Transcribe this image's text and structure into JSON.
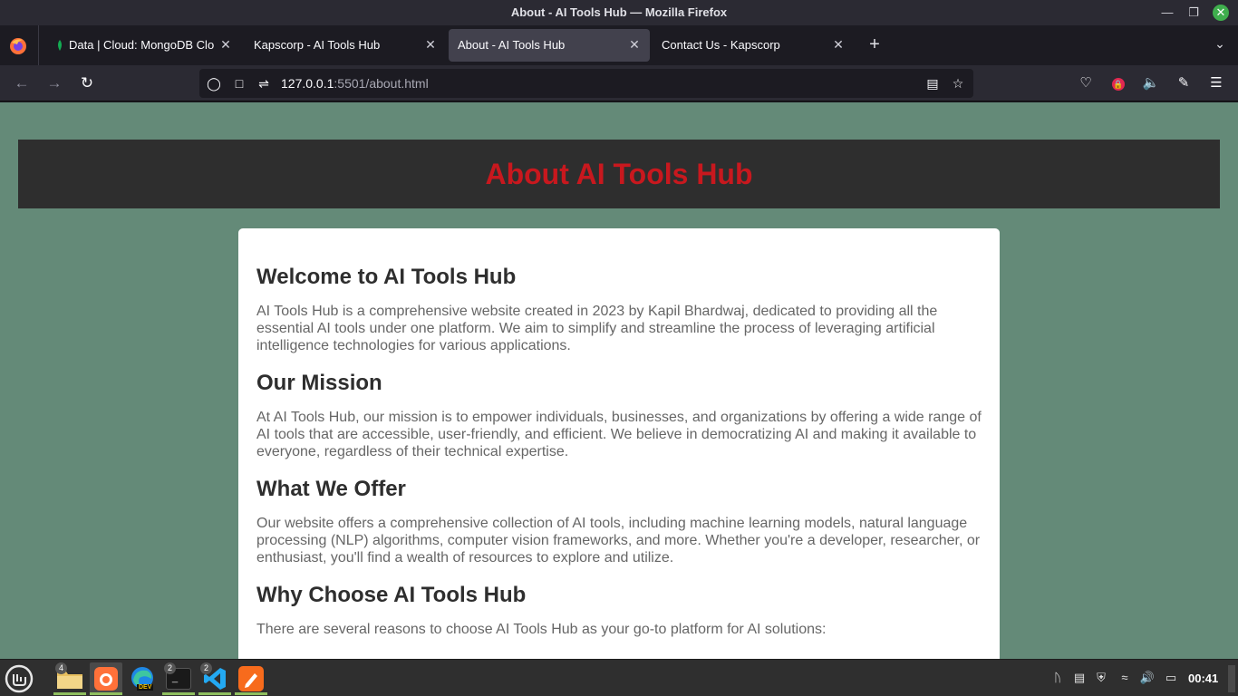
{
  "window": {
    "title": "About - AI Tools Hub — Mozilla Firefox"
  },
  "tabs": [
    {
      "label": "Data | Cloud: MongoDB Clo",
      "active": false
    },
    {
      "label": "Kapscorp - AI Tools Hub",
      "active": false
    },
    {
      "label": "About - AI Tools Hub",
      "active": true
    },
    {
      "label": "Contact Us - Kapscorp",
      "active": false
    }
  ],
  "urlbar": {
    "host": "127.0.0.1",
    "rest": ":5501/about.html"
  },
  "page": {
    "header_title": "About AI Tools Hub",
    "sections": [
      {
        "heading": "Welcome to AI Tools Hub",
        "text": "AI Tools Hub is a comprehensive website created in 2023 by Kapil Bhardwaj, dedicated to providing all the essential AI tools under one platform. We aim to simplify and streamline the process of leveraging artificial intelligence technologies for various applications."
      },
      {
        "heading": "Our Mission",
        "text": "At AI Tools Hub, our mission is to empower individuals, businesses, and organizations by offering a wide range of AI tools that are accessible, user-friendly, and efficient. We believe in democratizing AI and making it available to everyone, regardless of their technical expertise."
      },
      {
        "heading": "What We Offer",
        "text": "Our website offers a comprehensive collection of AI tools, including machine learning models, natural language processing (NLP) algorithms, computer vision frameworks, and more. Whether you're a developer, researcher, or enthusiast, you'll find a wealth of resources to explore and utilize."
      },
      {
        "heading": "Why Choose AI Tools Hub",
        "text": "There are several reasons to choose AI Tools Hub as your go-to platform for AI solutions:"
      }
    ]
  },
  "taskbar": {
    "files_badge": "4",
    "terminal_badge": "2",
    "vscode_badge": "2",
    "edge_label": "DEV",
    "clock": "00:41"
  },
  "colors": {
    "page_bg": "#648a78",
    "header_bg": "#2e2e2e",
    "header_text": "#c8181e",
    "card_bg": "#ffffff"
  }
}
